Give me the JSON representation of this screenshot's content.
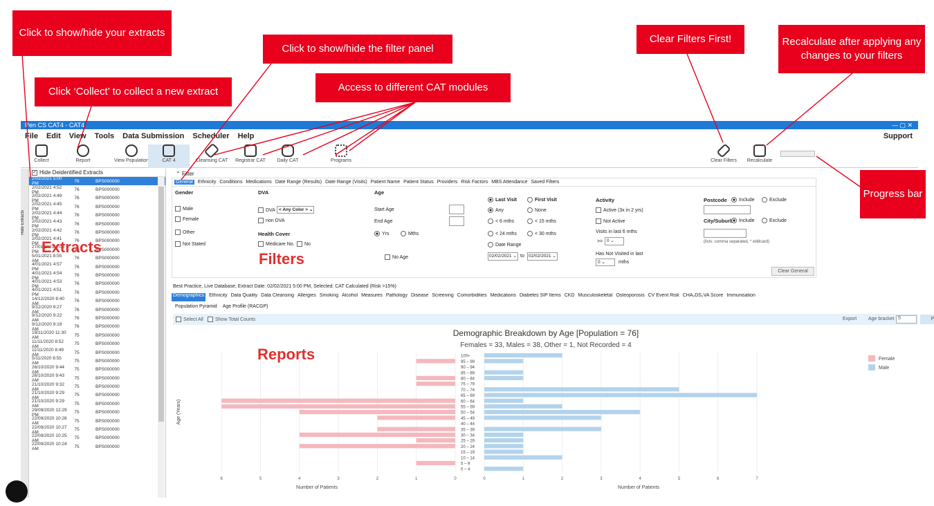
{
  "callouts": {
    "show_extracts": "Click to show/hide your extracts",
    "collect": "Click ‘Collect’ to collect a new extract",
    "filter_panel": "Click to show/hide the filter panel",
    "modules": "Access to different CAT modules",
    "clear_filters": "Clear Filters First!",
    "recalculate": "Recalculate after applying any changes to your filters",
    "progress_bar": "Progress bar"
  },
  "overlay_labels": {
    "extracts": "Extracts",
    "filters": "Filters",
    "reports": "Reports"
  },
  "window": {
    "title": "Pen CS CAT4 - CAT4",
    "accent": "#1e7ad6"
  },
  "menu": {
    "items": [
      "File",
      "Edit",
      "View",
      "Tools",
      "Data Submission",
      "Scheduler",
      "Help"
    ],
    "support": "Support"
  },
  "toolbar": {
    "buttons": [
      {
        "label": "Collect",
        "icon": "cart-icon"
      },
      {
        "label": "Report",
        "icon": "chart-icon"
      },
      {
        "label": "View Population",
        "icon": "people-icon"
      },
      {
        "label": "CAT 4",
        "icon": "bars-icon"
      },
      {
        "label": "Cleansing CAT",
        "icon": "brush-icon"
      },
      {
        "label": "Registrar CAT",
        "icon": "form-icon"
      },
      {
        "label": "Daily CAT",
        "icon": "hexagon-icon"
      },
      {
        "label": "Programs",
        "icon": "grid-icon"
      }
    ],
    "clear_filters": "Clear Filters",
    "recalculate": "Recalculate"
  },
  "sidebar": {
    "hide_extracts": "Hide Extracts"
  },
  "extracts": {
    "header": "Hide Deidentified Extracts",
    "rows": [
      [
        "2/02/2021 5:00 PM",
        "76",
        "BPS000000"
      ],
      [
        "2/02/2021 4:52 PM",
        "76",
        "BPS000000"
      ],
      [
        "2/02/2021 4:49 PM",
        "76",
        "BPS000000"
      ],
      [
        "2/02/2021 4:45 PM",
        "76",
        "BPS000000"
      ],
      [
        "2/02/2021 4:44 PM",
        "76",
        "BPS000000"
      ],
      [
        "2/02/2021 4:43 PM",
        "76",
        "BPS000000"
      ],
      [
        "2/02/2021 4:42 PM",
        "76",
        "BPS000000"
      ],
      [
        "2/02/2021 4:41 PM",
        "76",
        "BPS000000"
      ],
      [
        "27/01/2021 2:06 PM",
        "76",
        "BPS000000"
      ],
      [
        "5/01/2021 8:55 AM",
        "76",
        "BPS000000"
      ],
      [
        "4/01/2021 4:57 PM",
        "76",
        "BPS000000"
      ],
      [
        "4/01/2021 4:54 PM",
        "76",
        "BPS000000"
      ],
      [
        "4/01/2021 4:53 PM",
        "76",
        "BPS000000"
      ],
      [
        "4/01/2021 4:51 PM",
        "76",
        "BPS000000"
      ],
      [
        "14/12/2020 8:40 AM",
        "76",
        "BPS000000"
      ],
      [
        "9/12/2020 9:27 AM",
        "76",
        "BPS000000"
      ],
      [
        "9/12/2020 9:22 AM",
        "76",
        "BPS000000"
      ],
      [
        "9/12/2020 9:19 AM",
        "76",
        "BPS000000"
      ],
      [
        "19/11/2020 11:30 AM",
        "75",
        "BPS000000"
      ],
      [
        "11/11/2020 8:52 AM",
        "75",
        "BPS000000"
      ],
      [
        "11/11/2020 8:49 AM",
        "75",
        "BPS000000"
      ],
      [
        "5/11/2020 8:55 AM",
        "75",
        "BPS000000"
      ],
      [
        "26/10/2020 9:44 AM",
        "75",
        "BPS000000"
      ],
      [
        "26/10/2020 9:43 AM",
        "75",
        "BPS000000"
      ],
      [
        "21/10/2020 9:32 AM",
        "75",
        "BPS000000"
      ],
      [
        "21/10/2020 9:29 AM",
        "75",
        "BPS000000"
      ],
      [
        "21/10/2020 9:29 AM",
        "75",
        "BPS000000"
      ],
      [
        "29/09/2020 12:29 PM",
        "75",
        "BPS000000"
      ],
      [
        "22/09/2020 10:28 AM",
        "75",
        "BPS000000"
      ],
      [
        "22/09/2020 10:27 AM",
        "75",
        "BPS000000"
      ],
      [
        "22/09/2020 10:25 AM",
        "75",
        "BPS000000"
      ],
      [
        "22/09/2020 10:24 AM",
        "75",
        "BPS000000"
      ]
    ]
  },
  "filter": {
    "toggle": "Filter",
    "tabs": [
      "General",
      "Ethnicity",
      "Conditions",
      "Medications",
      "Date Range (Results)",
      "Date Range (Visits)",
      "Patient Name",
      "Patient Status",
      "Providers",
      "Risk Factors",
      "MBS Attendance",
      "Saved Filters"
    ],
    "gender": {
      "title": "Gender",
      "options": [
        "Male",
        "Female",
        "Other",
        "Not Stated"
      ]
    },
    "dva": {
      "title": "DVA",
      "dva": "DVA",
      "color": "< Any Color >",
      "non_dva": "non DVA",
      "health_cover": "Health Cover",
      "medicare": "Medicare No.",
      "no": "No"
    },
    "age": {
      "title": "Age",
      "start": "Start Age",
      "end": "End Age",
      "yrs": "Yrs",
      "mths": "Mths",
      "no_age": "No Age"
    },
    "visit": {
      "last": "Last Visit",
      "first": "First Visit",
      "any": "Any",
      "none": "None",
      "lt6": "< 6 mths",
      "lt15": "< 15 mths",
      "lt24": "< 24 mths",
      "lt30": "< 30 mths",
      "date_range": "Date Range",
      "from": "02/02/2021",
      "to_label": "to",
      "to": "02/02/2021"
    },
    "activity": {
      "title": "Activity",
      "active": "Active (3x in 2 yrs)",
      "not_active": "Not Active",
      "visits_label": "Visits in last 6 mths",
      "gte": ">=",
      "visits_val": "0",
      "not_visited": "Has Not Visited in last",
      "nv_val": "0",
      "mths": "mths"
    },
    "location": {
      "postcode": "Postcode",
      "include": "Include",
      "exclude": "Exclude",
      "city": "City/Suburb",
      "hint": "(lists: comma separated, * wildcard)",
      "clear_general": "Clear General"
    }
  },
  "status_line": "Best Practice, Live Database; Extract Date: 02/02/2021 5:00 PM, Selected: CAT Calculated (Risk >15%)",
  "report_tabs": [
    "Demographics",
    "Ethnicity",
    "Data Quality",
    "Data Cleansing",
    "Allergies",
    "Smoking",
    "Alcohol",
    "Measures",
    "Pathology",
    "Disease",
    "Screening",
    "Comorbidities",
    "Medications",
    "Diabetes SIP Items",
    "CKD",
    "Musculoskeletal",
    "Osteoporosis",
    "CV Event Risk",
    "CHA₂DS₂VA Score",
    "Immunisation"
  ],
  "sub_tabs": [
    "Population Pyramid",
    "Age Profile (RACGP)"
  ],
  "options": {
    "select_all": "Select All",
    "show_total": "Show Total Counts",
    "export": "Export",
    "age_bracket": "Age bracket",
    "bracket_val": "5",
    "print": "Print"
  },
  "chart_data": {
    "type": "bar",
    "title": "Demographic Breakdown by Age [Population = 76]",
    "subtitle": "Females = 33, Males = 38, Other = 1, Not Recorded = 4",
    "ylabel": "Age (Years)",
    "xlabel": "Number of Patients",
    "categories": [
      "100+",
      "95 – 99",
      "90 – 94",
      "85 – 89",
      "80 – 84",
      "75 – 79",
      "70 – 74",
      "65 – 69",
      "60 – 64",
      "55 – 59",
      "50 – 54",
      "45 – 49",
      "40 – 44",
      "35 – 39",
      "30 – 34",
      "25 – 29",
      "20 – 24",
      "15 – 19",
      "10 – 14",
      "5 – 9",
      "0 – 4"
    ],
    "series": [
      {
        "name": "Female",
        "color": "#f4b8bd",
        "values": [
          0,
          1,
          0,
          0,
          1,
          1,
          0,
          0,
          6,
          6,
          4,
          2,
          0,
          2,
          4,
          1,
          4,
          0,
          0,
          1,
          0
        ]
      },
      {
        "name": "Male",
        "color": "#b3d3ec",
        "values": [
          2,
          1,
          0,
          1,
          1,
          0,
          5,
          7,
          1,
          2,
          4,
          3,
          0,
          3,
          1,
          1,
          1,
          1,
          2,
          0,
          1
        ]
      }
    ],
    "xlim": [
      0,
      7
    ],
    "ticks": [
      "0",
      "1",
      "2",
      "3",
      "4",
      "5",
      "6",
      "7"
    ],
    "tick_labels_female": [
      "6",
      "5",
      "4",
      "3",
      "2",
      "1",
      "0"
    ]
  }
}
